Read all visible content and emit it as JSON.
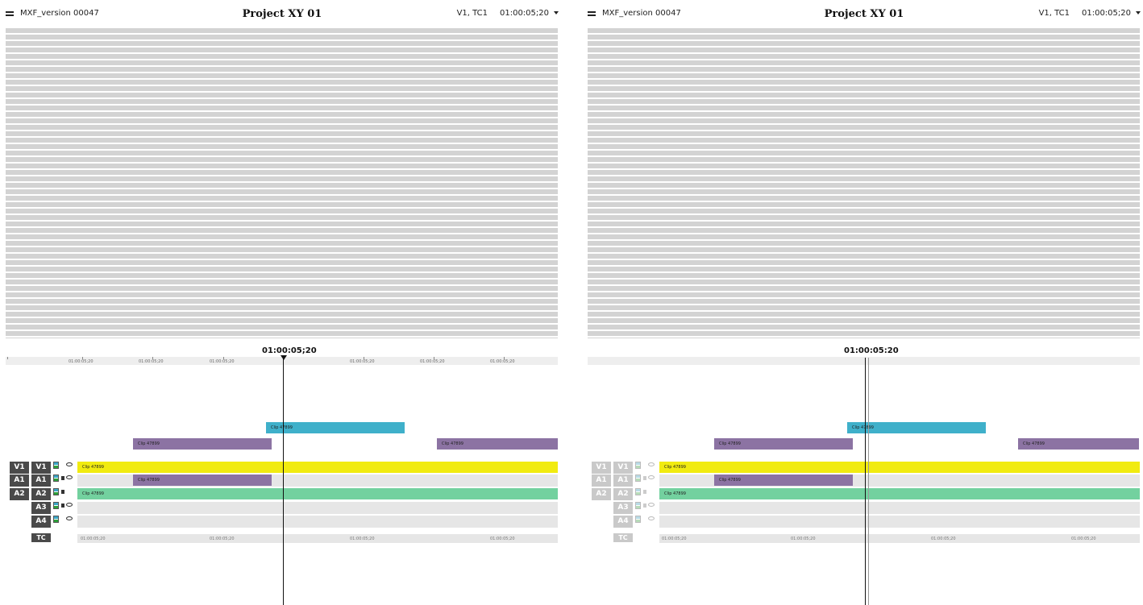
{
  "panels": [
    {
      "file_name": "MXF_version 00047",
      "project_title": "Project XY 01",
      "track_info": "V1, TC1",
      "timecode": "01:00:05;20",
      "playhead_time": "01:00:05;20",
      "ruler_labels": [
        "01:00:05;20",
        "01:00:05;20",
        "01:00:05;20",
        "01:00:05;20",
        "01:00:05;20",
        "01:00:05;20"
      ],
      "floating_clips": {
        "cyan": "Clip 47899",
        "purple_left": "Clip 47899",
        "purple_right": "Clip 47899"
      },
      "tracks": [
        {
          "src": "V1",
          "rec": "V1",
          "clip": "Clip 47899"
        },
        {
          "src": "A1",
          "rec": "A1",
          "clip": "Clip 47899"
        },
        {
          "src": "A2",
          "rec": "A2",
          "clip": "Clip 47899"
        },
        {
          "src": "",
          "rec": "A3",
          "clip": ""
        },
        {
          "src": "",
          "rec": "A4",
          "clip": ""
        }
      ],
      "tc_label": "TC",
      "tc_ruler_labels": [
        "01:00:05;20",
        "01:00:05;20",
        "01:00:05;20",
        "01:00:05;20"
      ]
    },
    {
      "file_name": "MXF_version 00047",
      "project_title": "Project XY 01",
      "track_info": "V1, TC1",
      "timecode": "01:00:05;20",
      "playhead_time": "01:00:05:20",
      "floating_clips": {
        "cyan": "Clip 47899",
        "purple_left": "Clip 47899",
        "purple_right": "Clip 47899"
      },
      "tracks": [
        {
          "src": "V1",
          "rec": "V1",
          "clip": "Clip 47899"
        },
        {
          "src": "A1",
          "rec": "A1",
          "clip": "Clip 47899"
        },
        {
          "src": "A2",
          "rec": "A2",
          "clip": "Clip 47899"
        },
        {
          "src": "",
          "rec": "A3",
          "clip": ""
        },
        {
          "src": "",
          "rec": "A4",
          "clip": ""
        }
      ],
      "tc_label": "TC",
      "tc_ruler_labels": [
        "01:00:05;20",
        "01:00:05;20",
        "01:00:05;20",
        "01:00:05;20"
      ]
    }
  ],
  "colors": {
    "cyan": "#3fb0ca",
    "purple": "#8c73a3",
    "yellow": "#f1eb10",
    "green": "#73d19f"
  }
}
